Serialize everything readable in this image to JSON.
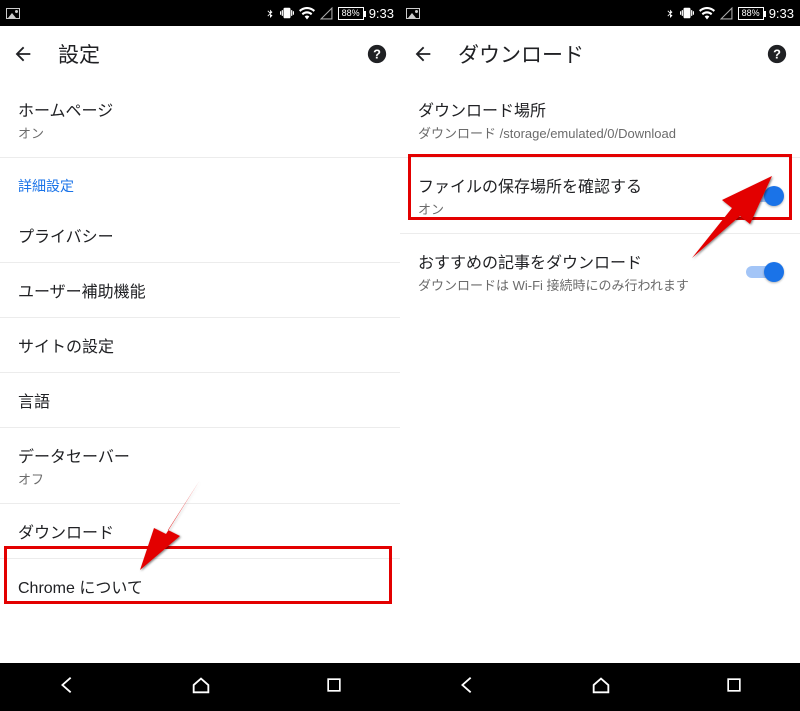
{
  "statusbar": {
    "battery": "88%",
    "time": "9:33"
  },
  "left_screen": {
    "title": "設定",
    "items": {
      "homepage": {
        "label": "ホームページ",
        "sub": "オン"
      },
      "advanced_header": "詳細設定",
      "privacy": "プライバシー",
      "accessibility": "ユーザー補助機能",
      "site_settings": "サイトの設定",
      "languages": "言語",
      "data_saver": {
        "label": "データセーバー",
        "sub": "オフ"
      },
      "download": "ダウンロード",
      "about": "Chrome について"
    }
  },
  "right_screen": {
    "title": "ダウンロード",
    "items": {
      "location": {
        "label": "ダウンロード場所",
        "sub": "ダウンロード /storage/emulated/0/Download"
      },
      "confirm_location": {
        "label": "ファイルの保存場所を確認する",
        "sub": "オン"
      },
      "suggested": {
        "label": "おすすめの記事をダウンロード",
        "sub": "ダウンロードは Wi-Fi 接続時にのみ行われます"
      }
    }
  }
}
